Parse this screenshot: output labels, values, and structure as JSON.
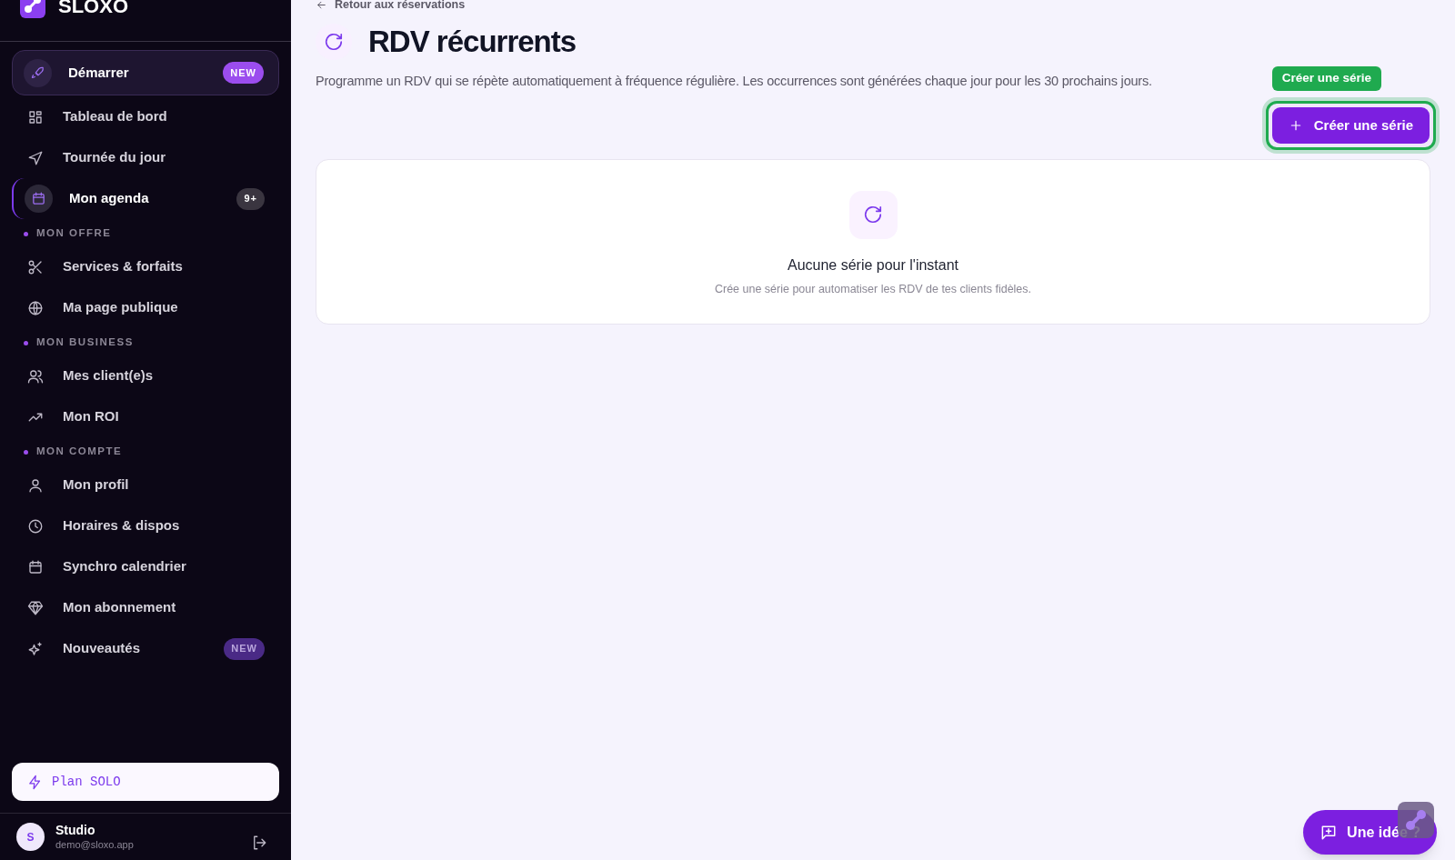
{
  "sidebar": {
    "brand": "SLOXO",
    "sections": [
      {
        "items": [
          {
            "label": "Démarrer",
            "selected": false,
            "featured": true,
            "badge": {
              "kind": "new",
              "text": "NEW"
            }
          },
          {
            "label": "Tableau de bord",
            "selected": false,
            "featured": false
          },
          {
            "label": "Tournée du jour",
            "selected": false,
            "featured": false
          },
          {
            "label": "Mon agenda",
            "selected": true,
            "featured": false,
            "badge": {
              "kind": "count",
              "text": "9+"
            }
          }
        ]
      },
      {
        "heading": "MON OFFRE",
        "items": [
          {
            "label": "Services & forfaits",
            "selected": false,
            "featured": false
          },
          {
            "label": "Ma page publique",
            "selected": false,
            "featured": false
          }
        ]
      },
      {
        "heading": "MON BUSINESS",
        "items": [
          {
            "label": "Mes client(e)s",
            "selected": false,
            "featured": false
          },
          {
            "label": "Mon ROI",
            "selected": false,
            "featured": false
          }
        ]
      },
      {
        "heading": "MON COMPTE",
        "items": [
          {
            "label": "Mon profil",
            "selected": false,
            "featured": false
          },
          {
            "label": "Horaires & dispos",
            "selected": false,
            "featured": false
          },
          {
            "label": "Synchro calendrier",
            "selected": false,
            "featured": false
          },
          {
            "label": "Mon abonnement",
            "selected": false,
            "featured": false
          },
          {
            "label": "Nouveautés",
            "selected": false,
            "featured": false,
            "badge": {
              "kind": "new-dim",
              "text": "NEW"
            }
          }
        ]
      }
    ],
    "plan": "Plan SOLO",
    "user": {
      "initial": "S",
      "name": "Studio",
      "email": "demo@sloxo.app"
    }
  },
  "back_link": "Retour aux réservations",
  "title": "RDV récurrents",
  "description": "Programme un RDV qui se répète automatiquement à fréquence régulière. Les occurrences sont générées chaque jour pour les 30 prochains jours.",
  "highlight_tag": "Créer une série",
  "create_button": "Créer une série",
  "empty_state": {
    "title": "Aucune série pour l'instant",
    "text": "Crée une série pour automatiser les RDV de tes clients fidèles."
  },
  "feedback_button": "Une idée ?"
}
